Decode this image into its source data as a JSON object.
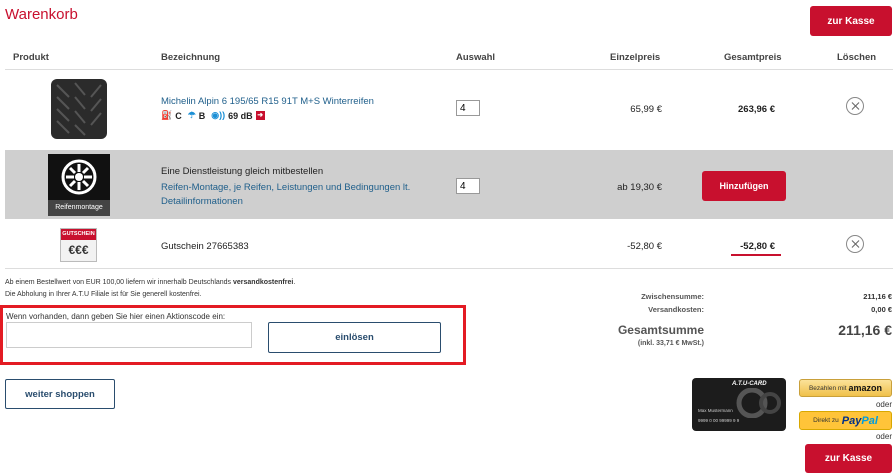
{
  "page": {
    "title": "Warenkorb",
    "checkout_label": "zur Kasse"
  },
  "columns": {
    "produkt": "Produkt",
    "bezeichnung": "Bezeichnung",
    "auswahl": "Auswahl",
    "einzelpreis": "Einzelpreis",
    "gesamtpreis": "Gesamtpreis",
    "loeschen": "Löschen"
  },
  "tire": {
    "name": "Michelin Alpin 6 195/65 R15 91T M+S Winterreifen",
    "fuel_class": "C",
    "wet_class": "B",
    "noise": "69 dB",
    "qty": "4",
    "unit_price": "65,99 €",
    "total_price": "263,96 €"
  },
  "service": {
    "icon_label": "Reifenmontage",
    "title": "Eine Dienstleistung gleich mitbestellen",
    "link": "Reifen-Montage, je Reifen, Leistungen und Bedingungen lt. Detailinformationen",
    "qty": "4",
    "price": "ab 19,30 €",
    "add_label": "Hinzufügen"
  },
  "voucher": {
    "badge": "GUTSCHEIN",
    "symbol": "€€€",
    "name": "Gutschein 27665383",
    "unit_price": "-52,80 €",
    "total_price": "-52,80 €"
  },
  "notes": {
    "shipping_prefix": "Ab einem Bestellwert von EUR 100,00 liefern wir innerhalb Deutschlands ",
    "shipping_bold": "versandkostenfrei",
    "shipping_suffix": ".",
    "pickup": "Die Abholung in Ihrer A.T.U Filiale ist für Sie generell kostenfrei."
  },
  "promo": {
    "label": "Wenn vorhanden, dann geben Sie hier einen Aktionscode ein:",
    "value": "",
    "redeem_label": "einlösen"
  },
  "summary": {
    "subtotal_label": "Zwischensumme:",
    "subtotal": "211,16 €",
    "shipping_label": "Versandkosten:",
    "shipping": "0,00 €",
    "total_label": "Gesamtsumme",
    "total": "211,16 €",
    "vat_note": "(inkl. 33,71 € MwSt.)"
  },
  "continue_label": "weiter shoppen",
  "payments": {
    "amazon_prefix": "Bezahlen mit",
    "amazon_brand": "amazon",
    "paypal_prefix": "Direkt zu",
    "paypal_brand_1": "Pay",
    "paypal_brand_2": "Pal",
    "or": "oder",
    "card_brand": "A.T.U-CARD",
    "card_holder": "Max Mustermann",
    "card_number": "9999 0 00 99999 9 9"
  },
  "colors": {
    "accent": "#c8102e",
    "link": "#1f5f8b",
    "promo_highlight": "#e31b23"
  }
}
